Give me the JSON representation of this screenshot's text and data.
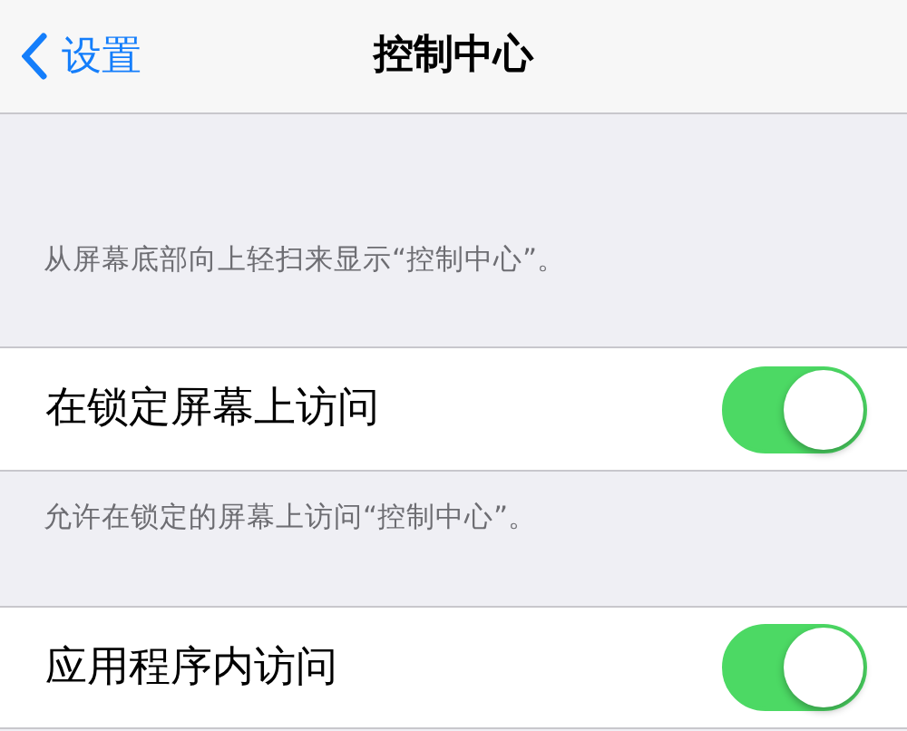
{
  "nav_bar": {
    "back_label": "设置",
    "title": "控制中心"
  },
  "items": [
    {
      "kind": "note",
      "text": "从屏幕底部向上轻扫来显示“控制中心”。"
    },
    {
      "kind": "switch",
      "label": "在锁定屏幕上访问",
      "on": true
    },
    {
      "kind": "note",
      "text": "允许在锁定的屏幕上访问“控制中心”。"
    },
    {
      "kind": "switch",
      "label": "应用程序内访问",
      "on": true
    }
  ]
}
